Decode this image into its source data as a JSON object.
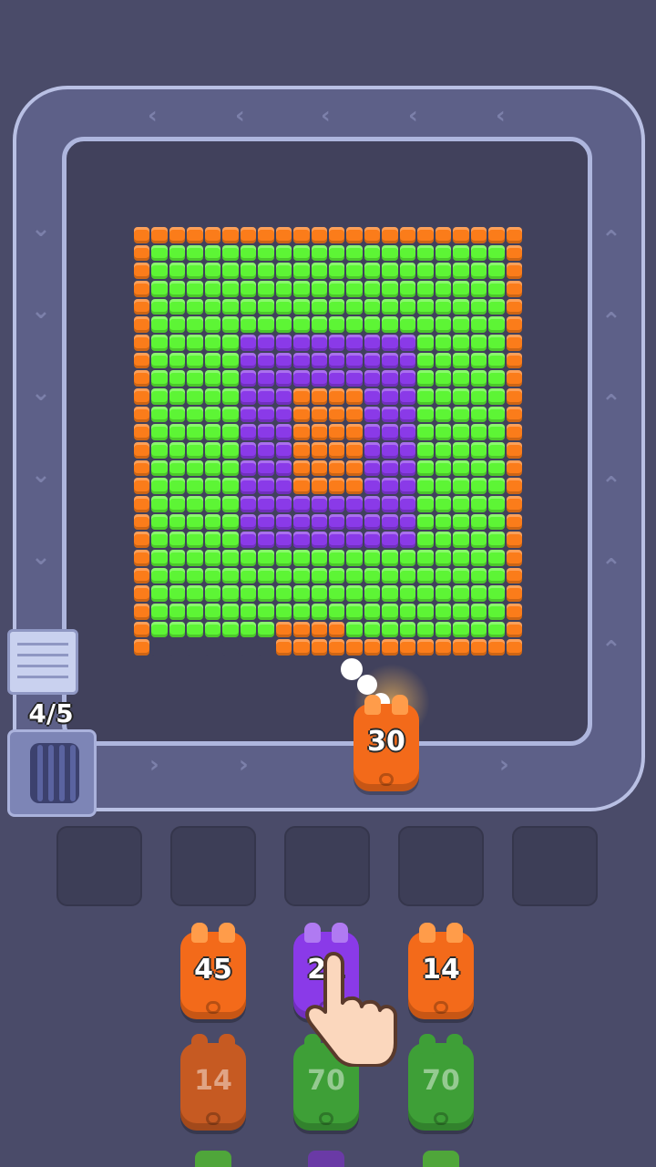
{
  "hud": {
    "stock_counter": "4/5"
  },
  "board": {
    "colors": {
      "orange": "#fb7c1a",
      "green": "#5df535",
      "purple": "#8a3ae8",
      "empty": "#41415c"
    },
    "layers": [
      {
        "name": "outer-border",
        "color": "orange"
      },
      {
        "name": "green-field",
        "color": "green"
      },
      {
        "name": "purple-ring",
        "color": "purple"
      },
      {
        "name": "orange-core",
        "color": "orange"
      }
    ]
  },
  "active_shooter": {
    "label": "30",
    "color": "orange"
  },
  "slots": {
    "count": 5
  },
  "queue": [
    {
      "label": "45",
      "color": "orange",
      "dim": false
    },
    {
      "label": "21",
      "color": "purple",
      "dim": false
    },
    {
      "label": "14",
      "color": "orange",
      "dim": false
    },
    {
      "label": "14",
      "color": "orange",
      "dim": true
    },
    {
      "label": "70",
      "color": "green",
      "dim": true
    },
    {
      "label": "70",
      "color": "green",
      "dim": true
    }
  ],
  "icons": {
    "conveyor_arrow": "chevron-icon",
    "tutorial_hand": "pointing-hand-icon",
    "stock_spool": "spool-icon"
  }
}
